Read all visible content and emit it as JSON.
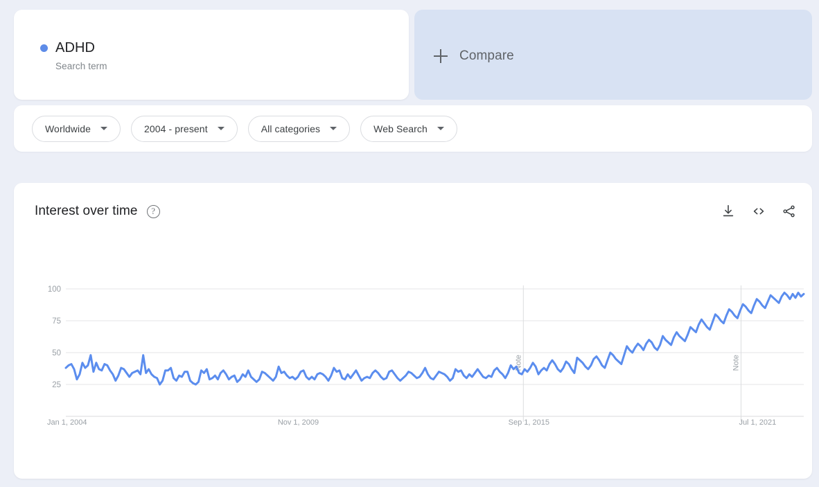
{
  "search_term": {
    "name": "ADHD",
    "type_label": "Search term",
    "dot_color": "#5e8ce8"
  },
  "compare": {
    "label": "Compare",
    "icon": "plus-icon"
  },
  "filters": [
    {
      "label": "Worldwide",
      "icon": "chevron-down-icon"
    },
    {
      "label": "2004 - present",
      "icon": "chevron-down-icon"
    },
    {
      "label": "All categories",
      "icon": "chevron-down-icon"
    },
    {
      "label": "Web Search",
      "icon": "chevron-down-icon"
    }
  ],
  "chart_panel": {
    "title": "Interest over time",
    "help_icon": "help-circle-icon",
    "help_glyph": "?",
    "actions": [
      {
        "name": "download-icon",
        "title": "Download"
      },
      {
        "name": "embed-code-icon",
        "title": "Embed"
      },
      {
        "name": "share-icon",
        "title": "Share"
      }
    ]
  },
  "chart_data": {
    "type": "line",
    "title": "Interest over time",
    "xlabel": "",
    "ylabel": "",
    "ylim": [
      0,
      100
    ],
    "y_ticks": [
      25,
      50,
      75,
      100
    ],
    "x_tick_labels": [
      "Jan 1, 2004",
      "Nov 1, 2009",
      "Sep 1, 2015",
      "Jul 1, 2021"
    ],
    "x_tick_positions": [
      0,
      0.3125,
      0.625,
      0.9375
    ],
    "grid": true,
    "legend": "none",
    "line_color": "#5b8dee",
    "line_width": 3,
    "annotations": [
      {
        "label": "Note",
        "x_frac": 0.62
      },
      {
        "label": "Note",
        "x_frac": 0.915
      }
    ],
    "series": [
      {
        "name": "ADHD",
        "color": "#5b8dee",
        "values": [
          38,
          40,
          41,
          37,
          29,
          33,
          42,
          38,
          40,
          48,
          35,
          42,
          37,
          36,
          41,
          40,
          36,
          33,
          28,
          32,
          38,
          37,
          34,
          31,
          34,
          35,
          36,
          33,
          48,
          34,
          37,
          33,
          31,
          30,
          25,
          28,
          36,
          36,
          38,
          30,
          28,
          32,
          31,
          35,
          35,
          28,
          26,
          25,
          27,
          36,
          34,
          37,
          29,
          30,
          32,
          29,
          34,
          36,
          33,
          29,
          31,
          32,
          27,
          29,
          33,
          31,
          36,
          31,
          29,
          27,
          29,
          35,
          34,
          32,
          30,
          28,
          31,
          39,
          34,
          35,
          32,
          30,
          31,
          29,
          31,
          35,
          36,
          31,
          29,
          31,
          29,
          33,
          34,
          33,
          31,
          28,
          32,
          38,
          35,
          36,
          30,
          29,
          33,
          30,
          33,
          36,
          32,
          28,
          30,
          31,
          30,
          34,
          36,
          34,
          31,
          29,
          30,
          35,
          36,
          33,
          30,
          28,
          30,
          32,
          35,
          34,
          32,
          30,
          31,
          34,
          38,
          33,
          30,
          29,
          32,
          35,
          34,
          33,
          31,
          28,
          30,
          37,
          35,
          36,
          32,
          30,
          33,
          31,
          34,
          37,
          34,
          31,
          30,
          32,
          31,
          36,
          38,
          35,
          33,
          30,
          34,
          40,
          37,
          39,
          34,
          33,
          37,
          35,
          38,
          42,
          39,
          33,
          36,
          38,
          36,
          41,
          44,
          41,
          37,
          35,
          38,
          43,
          41,
          37,
          34,
          46,
          44,
          42,
          39,
          37,
          40,
          45,
          47,
          44,
          40,
          38,
          44,
          50,
          48,
          45,
          43,
          41,
          48,
          55,
          52,
          50,
          54,
          57,
          55,
          52,
          57,
          60,
          58,
          54,
          52,
          56,
          63,
          60,
          58,
          56,
          62,
          66,
          63,
          61,
          59,
          64,
          70,
          68,
          66,
          72,
          76,
          73,
          70,
          68,
          74,
          80,
          78,
          75,
          73,
          79,
          84,
          82,
          79,
          77,
          83,
          88,
          86,
          83,
          81,
          87,
          92,
          90,
          87,
          85,
          90,
          95,
          93,
          91,
          89,
          94,
          97,
          95,
          92,
          96,
          93,
          97,
          94,
          96
        ]
      }
    ]
  }
}
